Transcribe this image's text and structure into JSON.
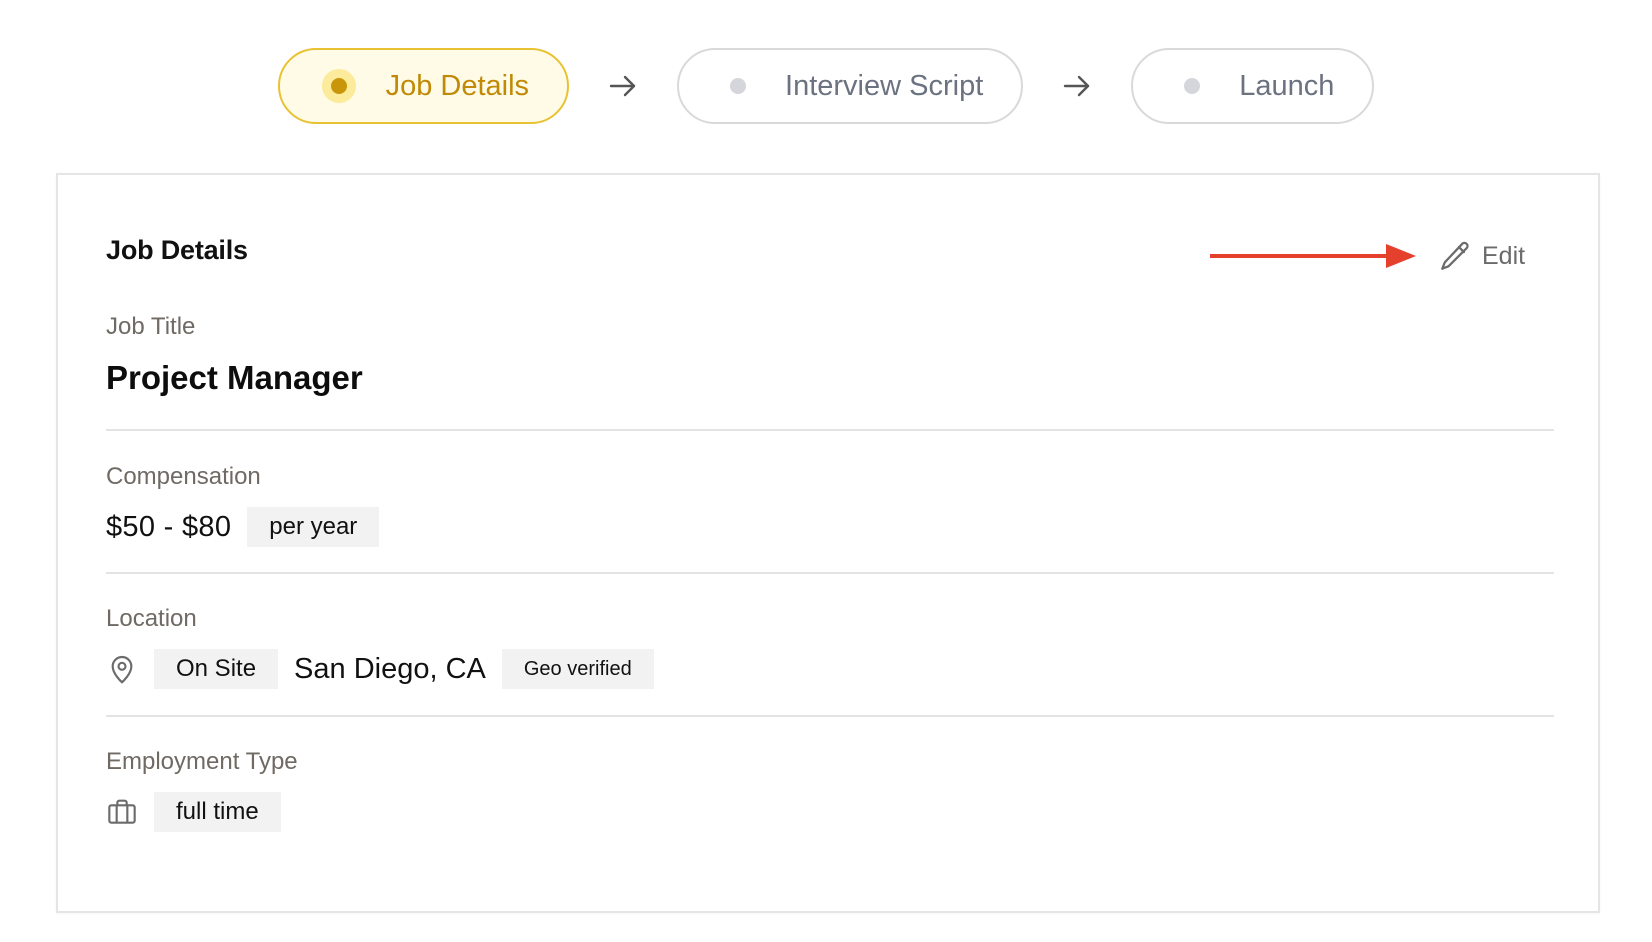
{
  "stepper": {
    "steps": [
      {
        "label": "Job Details",
        "active": true
      },
      {
        "label": "Interview Script",
        "active": false
      },
      {
        "label": "Launch",
        "active": false
      }
    ]
  },
  "card": {
    "title": "Job Details",
    "edit_label": "Edit",
    "job_title": {
      "label": "Job Title",
      "value": "Project Manager"
    },
    "compensation": {
      "label": "Compensation",
      "range": "$50 - $80",
      "period": "per year"
    },
    "location": {
      "label": "Location",
      "mode": "On Site",
      "city": "San Diego, CA",
      "badge": "Geo verified"
    },
    "employment": {
      "label": "Employment Type",
      "value": "full time"
    }
  },
  "colors": {
    "accent": "#e9c234",
    "accent_text": "#c08a06",
    "annotation_arrow": "#e5402c"
  },
  "icons": {
    "step_separator": "arrow-right-icon",
    "edit": "pencil-icon",
    "location": "map-pin-icon",
    "employment": "briefcase-icon"
  }
}
